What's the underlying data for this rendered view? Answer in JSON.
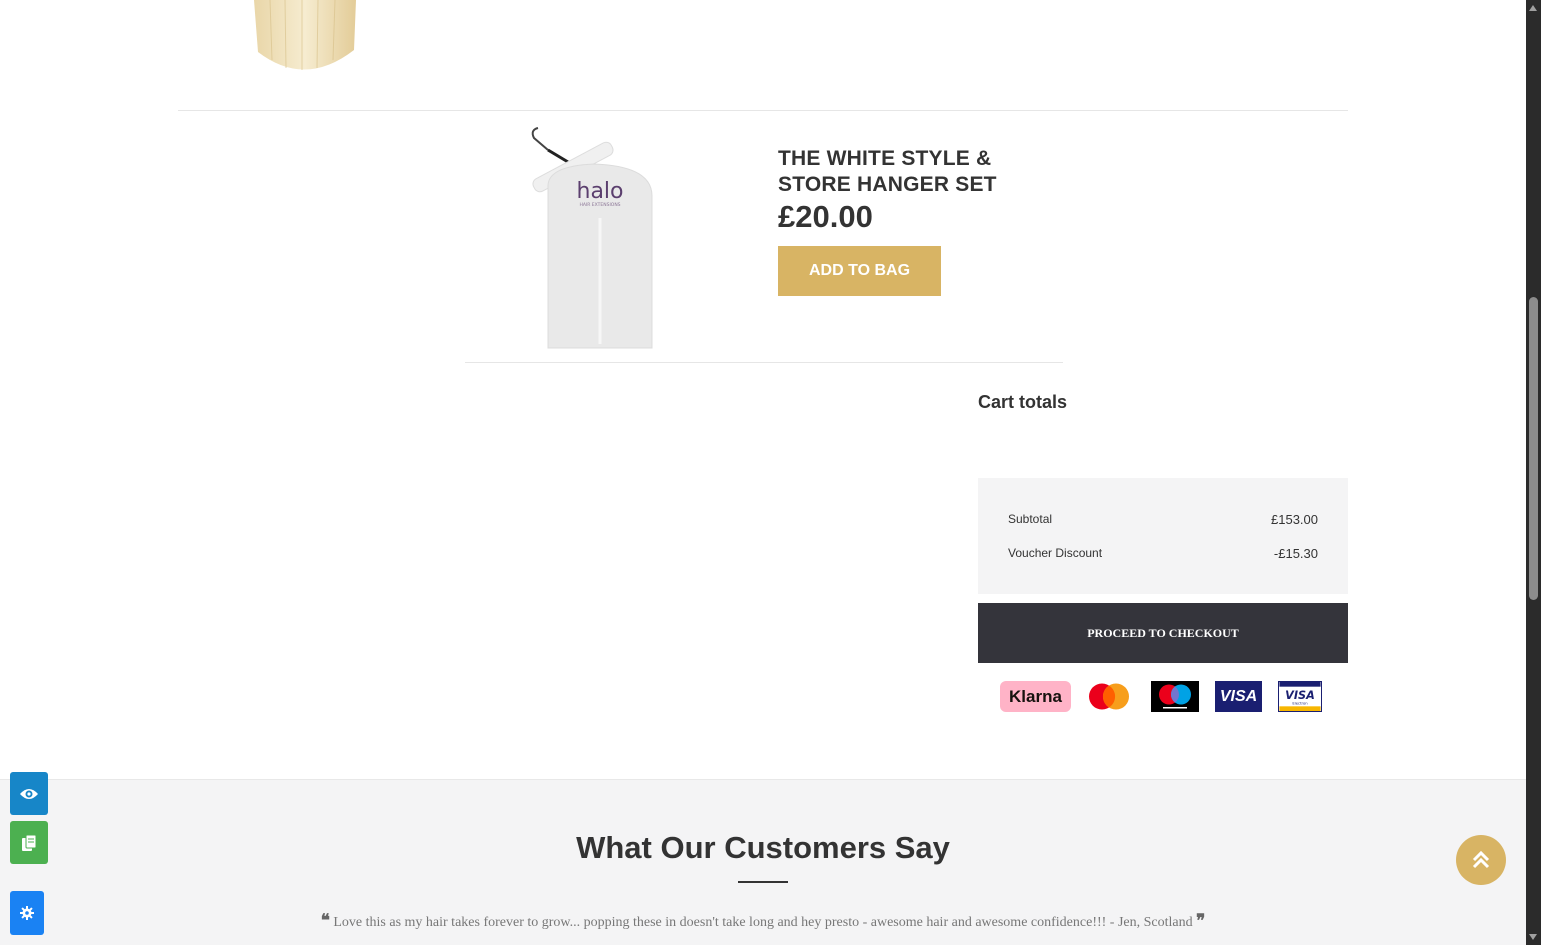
{
  "product": {
    "title": "THE WHITE STYLE & STORE HANGER SET",
    "price": "£20.00",
    "add_label": "ADD TO BAG",
    "image_brand": "halo",
    "image_brand_sub": "HAIR EXTENSIONS"
  },
  "cart_totals": {
    "title": "Cart totals",
    "rows": [
      {
        "label": "Subtotal",
        "value": "£153.00"
      },
      {
        "label": "Voucher Discount",
        "value": "-£15.30"
      }
    ],
    "checkout_label": "PROCEED TO CHECKOUT"
  },
  "payments": {
    "klarna": "Klarna",
    "visa": "VISA",
    "visa_electron": "VISA",
    "visa_electron_sub": "Electron"
  },
  "testimonials": {
    "heading": "What Our Customers Say",
    "quote": "Love this as my hair takes forever to grow... popping these in doesn't take long and hey presto - awesome hair and awesome confidence!!! - Jen, Scotland"
  },
  "colors": {
    "accent_gold": "#d8b464",
    "checkout_dark": "#34343b",
    "panel_grey": "#f4f4f5"
  }
}
